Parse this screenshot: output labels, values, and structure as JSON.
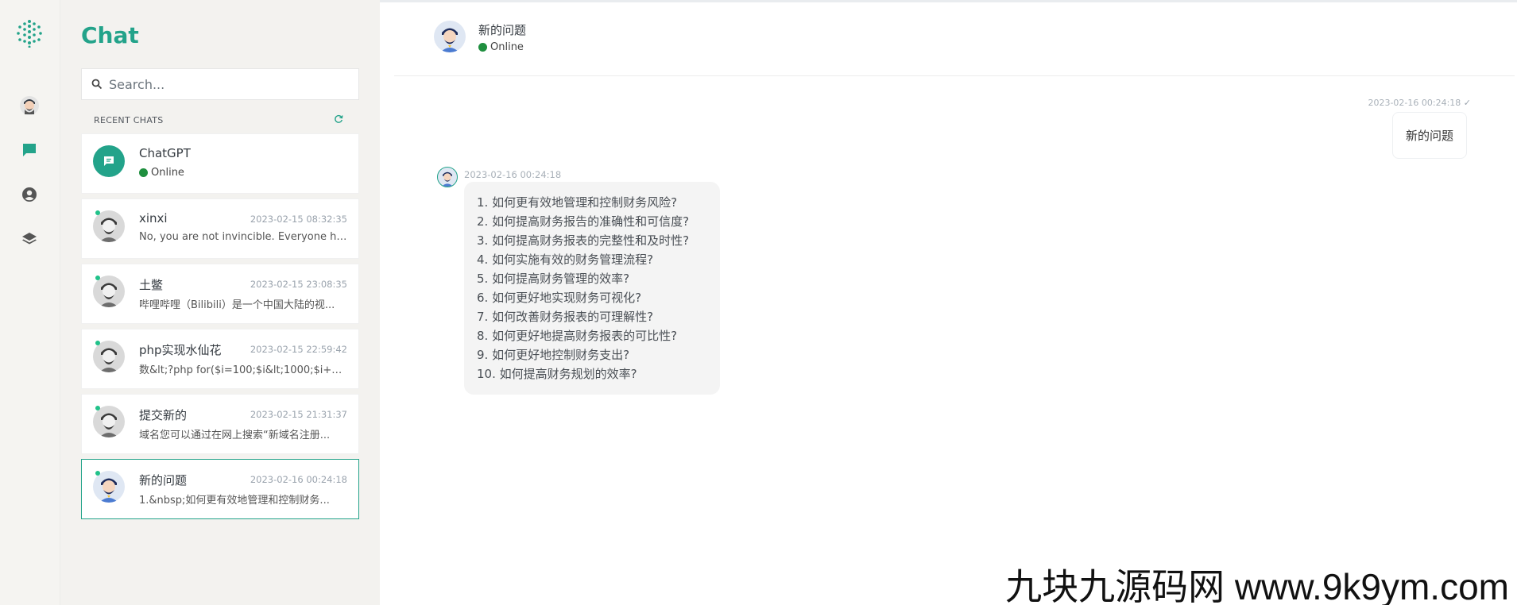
{
  "sidebar_rail": {
    "items": [
      "avatar-icon",
      "chat-icon",
      "user-circle-icon",
      "layers-icon"
    ]
  },
  "panel": {
    "title": "Chat",
    "search_placeholder": "Search...",
    "recent_header": "RECENT CHATS"
  },
  "chats": [
    {
      "name": "ChatGPT",
      "status": "Online"
    },
    {
      "name": "xinxi",
      "time": "2023-02-15 08:32:35",
      "preview": "No, you are not invincible. Everyone has..."
    },
    {
      "name": "土鳖",
      "time": "2023-02-15 23:08:35",
      "preview": "哔哩哔哩（Bilibili）是一个中国大陆的视..."
    },
    {
      "name": "php实现水仙花",
      "time": "2023-02-15 22:59:42",
      "preview": "数&lt;?php for($i=100;$i&lt;1000;$i++)..."
    },
    {
      "name": "提交新的",
      "time": "2023-02-15 21:31:37",
      "preview": "域名您可以通过在网上搜索“新域名注册..."
    },
    {
      "name": "新的问题",
      "time": "2023-02-16 00:24:18",
      "preview": "1.&nbsp;如何更有效地管理和控制财务..."
    }
  ],
  "conversation": {
    "title": "新的问题",
    "status": "Online",
    "outgoing": {
      "time": "2023-02-16 00:24:18",
      "text": "新的问题"
    },
    "incoming": {
      "time": "2023-02-16 00:24:18",
      "lines": [
        "1. 如何更有效地管理和控制财务风险?",
        "2. 如何提高财务报告的准确性和可信度?",
        "3. 如何提高财务报表的完整性和及时性?",
        "4. 如何实施有效的财务管理流程?",
        "5. 如何提高财务管理的效率?",
        "6. 如何更好地实现财务可视化?",
        "7. 如何改善财务报表的可理解性?",
        "8. 如何更好地提高财务报表的可比性?",
        "9. 如何更好地控制财务支出?",
        "10. 如何提高财务规划的效率?"
      ]
    }
  },
  "watermark": "九块九源码网 www.9k9ym.com",
  "colors": {
    "accent": "#23a38a",
    "online": "#1f8f3f"
  }
}
